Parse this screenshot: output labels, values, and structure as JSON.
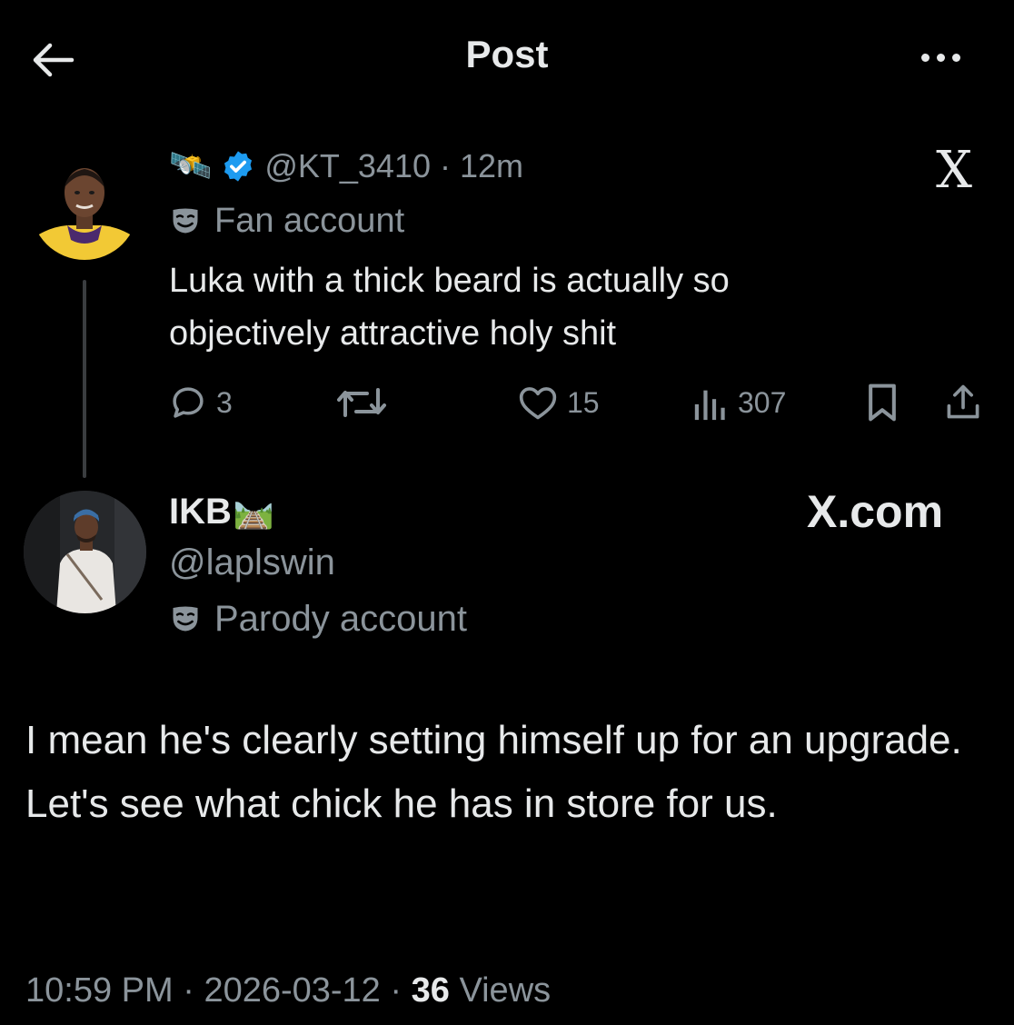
{
  "header": {
    "title": "Post"
  },
  "quoted_post": {
    "emoji": "🛰️",
    "handle": "@KT_3410",
    "separator": "·",
    "time": "12m",
    "account_label": "Fan account",
    "text": "Luka with a thick beard is actually so objectively attractive holy shit",
    "watermark": "X",
    "actions": {
      "replies": "3",
      "reposts": "",
      "likes": "15",
      "views": "307"
    }
  },
  "reply_post": {
    "name": "IKB",
    "name_emoji": "🛤️",
    "handle": "@laplswin",
    "account_label": "Parody account",
    "watermark": "X.com",
    "text": "I mean he's clearly setting himself up for an upgrade. Let's see what chick he has in store for us.",
    "time": "10:59 PM",
    "date": "2026-03-12",
    "separator": "·",
    "view_count": "36",
    "views_label": "Views"
  },
  "colors": {
    "background": "#000000",
    "primary_text": "#e7e9ea",
    "secondary_text": "#8b949b",
    "verified_badge": "#1d9bf0"
  }
}
